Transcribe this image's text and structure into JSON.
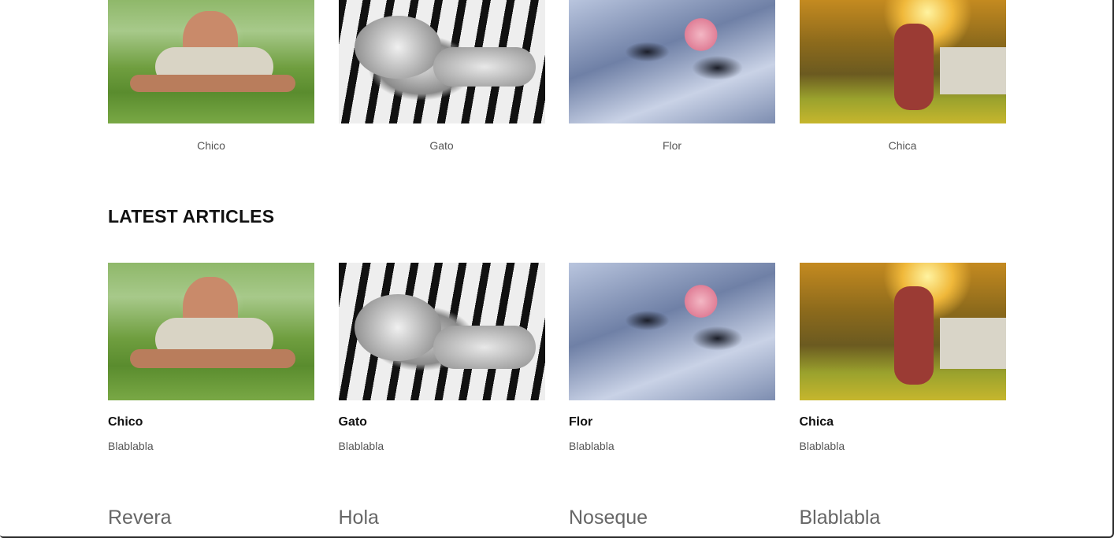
{
  "top_row": {
    "items": [
      {
        "caption": "Chico",
        "image": "man-doing-pushups-photo"
      },
      {
        "caption": "Gato",
        "image": "kitten-on-piano-photo"
      },
      {
        "caption": "Flor",
        "image": "rose-on-stones-photo"
      },
      {
        "caption": "Chica",
        "image": "girl-in-sunlight-photo"
      }
    ]
  },
  "latest_articles": {
    "heading": "LATEST ARTICLES",
    "items": [
      {
        "title": "Chico",
        "description": "Blablabla",
        "image": "man-doing-pushups-photo"
      },
      {
        "title": "Gato",
        "description": "Blablabla",
        "image": "kitten-on-piano-photo"
      },
      {
        "title": "Flor",
        "description": "Blablabla",
        "image": "rose-on-stones-photo"
      },
      {
        "title": "Chica",
        "description": "Blablabla",
        "image": "girl-in-sunlight-photo"
      }
    ]
  },
  "bottom_row": {
    "items": [
      "Revera",
      "Hola",
      "Noseque",
      "Blablabla"
    ]
  }
}
